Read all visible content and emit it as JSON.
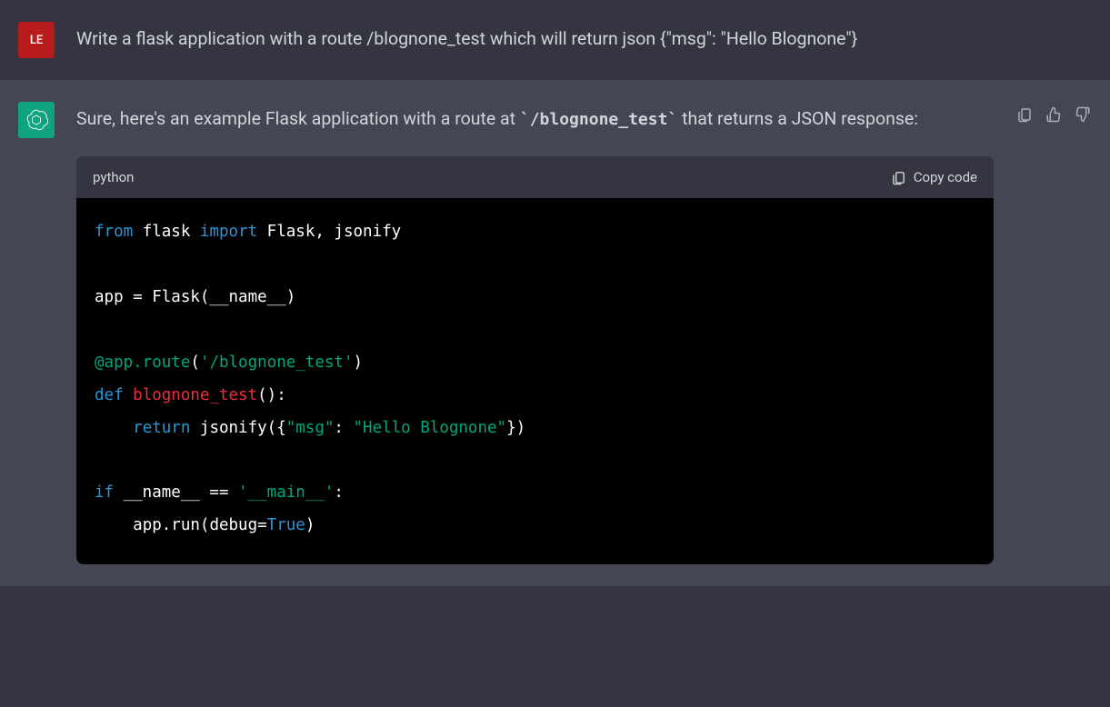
{
  "user": {
    "avatar_label": "LE",
    "message": "Write a flask application with a route /blognone_test which will return json {\"msg\": \"Hello Blognone\"}"
  },
  "assistant": {
    "intro_before": "Sure, here's an example Flask application with a route at ",
    "inline_code": "`/blognone_test`",
    "intro_after": " that returns a JSON response:"
  },
  "code_block": {
    "language": "python",
    "copy_label": "Copy code",
    "tokens": {
      "from": "from",
      "flask_mod": " flask ",
      "import": "import",
      "imports": " Flask, jsonify",
      "app_eq": "app = Flask(__name__)",
      "decorator_at": "@app.route",
      "dec_open": "(",
      "route_str": "'/blognone_test'",
      "dec_close": ")",
      "def": "def ",
      "fn": "blognone_test",
      "fn_tail": "():",
      "indent": "    ",
      "return": "return",
      "jsonify_call_open": " jsonify({",
      "msg_key": "\"msg\"",
      "colon_sp": ": ",
      "msg_val": "\"Hello Blognone\"",
      "jsonify_call_close": "})",
      "if": "if",
      "name_eq": " __name__ == ",
      "main_str": "'__main__'",
      "if_tail": ":",
      "run_open": "app.run(debug=",
      "true": "True",
      "run_close": ")"
    }
  }
}
